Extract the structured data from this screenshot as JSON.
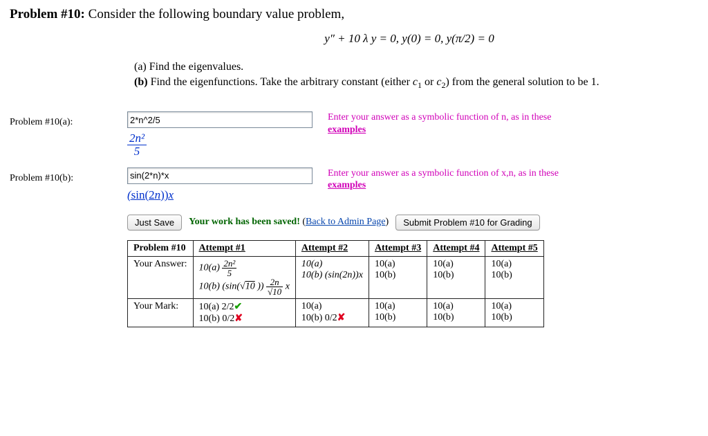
{
  "problem": {
    "title_prefix": "Problem #10:",
    "title_rest": " Consider the following boundary value problem,",
    "equation": "y″ + 10 λ y  =  0,   y(0)  =  0,   y(π/2)  =  0",
    "part_a": "(a) Find the eigenvalues.",
    "part_b": "(b) Find the eigenfunctions. Take the arbitrary constant (either c₁ or c₂) from the general solution to be 1."
  },
  "inputs": {
    "a": {
      "label": "Problem #10(a):",
      "value": "2*n^2/5",
      "rendered_num": "2n²",
      "rendered_den": "5",
      "hint_pre": "Enter your answer as a symbolic function of n, as in these ",
      "hint_link": "examples"
    },
    "b": {
      "label": "Problem #10(b):",
      "value": "sin(2*n)*x",
      "rendered": "(sin(2n))x",
      "hint_pre": "Enter your answer as a symbolic function of x,n, as in these ",
      "hint_link": "examples"
    }
  },
  "buttons": {
    "save": "Just Save",
    "saved_msg": "Your work has been saved!",
    "back": "Back to Admin Page",
    "submit": "Submit Problem #10 for Grading"
  },
  "table": {
    "header_problem": "Problem #10",
    "row_answer": "Your Answer:",
    "row_mark": "Your Mark:",
    "attempts": [
      "Attempt #1",
      "Attempt #2",
      "Attempt #3",
      "Attempt #4",
      "Attempt #5"
    ],
    "answers": {
      "a1_a_prefix": "10(a) ",
      "a1_a_num": "2n²",
      "a1_a_den": "5",
      "a1_b_prefix": "10(b) (sin(√",
      "a1_b_rad": "10",
      "a1_b_mid": " )) ",
      "a1_b_fr_num": "2n",
      "a1_b_fr_den": "√10",
      "a1_b_suffix": " x",
      "a2_a": "10(a)",
      "a2_b": "10(b) (sin(2n))x",
      "a3_a": "10(a)",
      "a3_b": "10(b)",
      "a4_a": "10(a)",
      "a4_b": "10(b)",
      "a5_a": "10(a)",
      "a5_b": "10(b)"
    },
    "marks": {
      "m1_a": "10(a) 2/2",
      "m1_a_mark": "✔",
      "m1_b": "10(b) 0/2",
      "m1_b_mark": "✘",
      "m2_a": "10(a)",
      "m2_b": "10(b) 0/2",
      "m2_b_mark": "✘",
      "m3_a": "10(a)",
      "m3_b": "10(b)",
      "m4_a": "10(a)",
      "m4_b": "10(b)",
      "m5_a": "10(a)",
      "m5_b": "10(b)"
    }
  }
}
